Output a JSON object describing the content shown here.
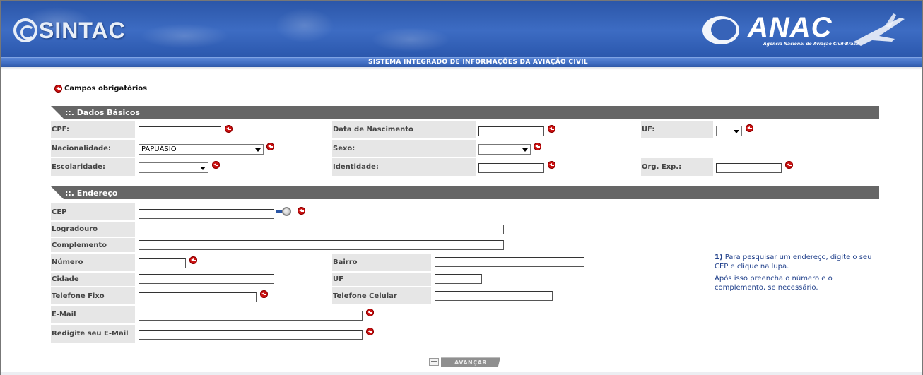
{
  "header": {
    "logo_left": "SINTAC",
    "logo_right": "ANAC",
    "logo_right_sub": "Agência Nacional de Aviação Civil-Brasil",
    "band_title": "SISTEMA INTEGRADO DE INFORMAÇÕES DA AVIAÇÃO CIVIL"
  },
  "required_note": "Campos obrigatórios",
  "dados_basicos": {
    "title": "::. Dados Básicos",
    "cpf": {
      "label": "CPF:",
      "value": ""
    },
    "data_nascimento": {
      "label": "Data de Nascimento",
      "value": ""
    },
    "uf": {
      "label": "UF:",
      "value": ""
    },
    "nacionalidade": {
      "label": "Nacionalidade:",
      "value": "PAPUÁSIO"
    },
    "sexo": {
      "label": "Sexo:",
      "value": ""
    },
    "escolaridade": {
      "label": "Escolaridade:",
      "value": ""
    },
    "identidade": {
      "label": "Identidade:",
      "value": ""
    },
    "org_exp": {
      "label": "Org. Exp.:",
      "value": ""
    }
  },
  "endereco": {
    "title": "::. Endereço",
    "cep": {
      "label": "CEP",
      "value": ""
    },
    "logradouro": {
      "label": "Logradouro",
      "value": ""
    },
    "complemento": {
      "label": "Complemento",
      "value": ""
    },
    "numero": {
      "label": "Número",
      "value": ""
    },
    "bairro": {
      "label": "Bairro",
      "value": ""
    },
    "cidade": {
      "label": "Cidade",
      "value": ""
    },
    "uf": {
      "label": "UF",
      "value": ""
    },
    "telefone_fixo": {
      "label": "Telefone Fixo",
      "value": ""
    },
    "telefone_celular": {
      "label": "Telefone Celular",
      "value": ""
    },
    "email": {
      "label": "E-Mail",
      "value": ""
    },
    "email_confirm": {
      "label": "Redigite seu E-Mail",
      "value": ""
    }
  },
  "help": {
    "step": "1)",
    "line1": "Para pesquisar um endereço, digite o seu CEP e clique na lupa.",
    "line2": "Após isso preencha o número e o complemento, se necessário."
  },
  "footer": {
    "next_label": "AVANÇAR"
  },
  "colors": {
    "header_blue": "#3d6cc3",
    "section_gray": "#666666",
    "label_gray": "#e6e6e6",
    "required_red": "#cc1111"
  }
}
